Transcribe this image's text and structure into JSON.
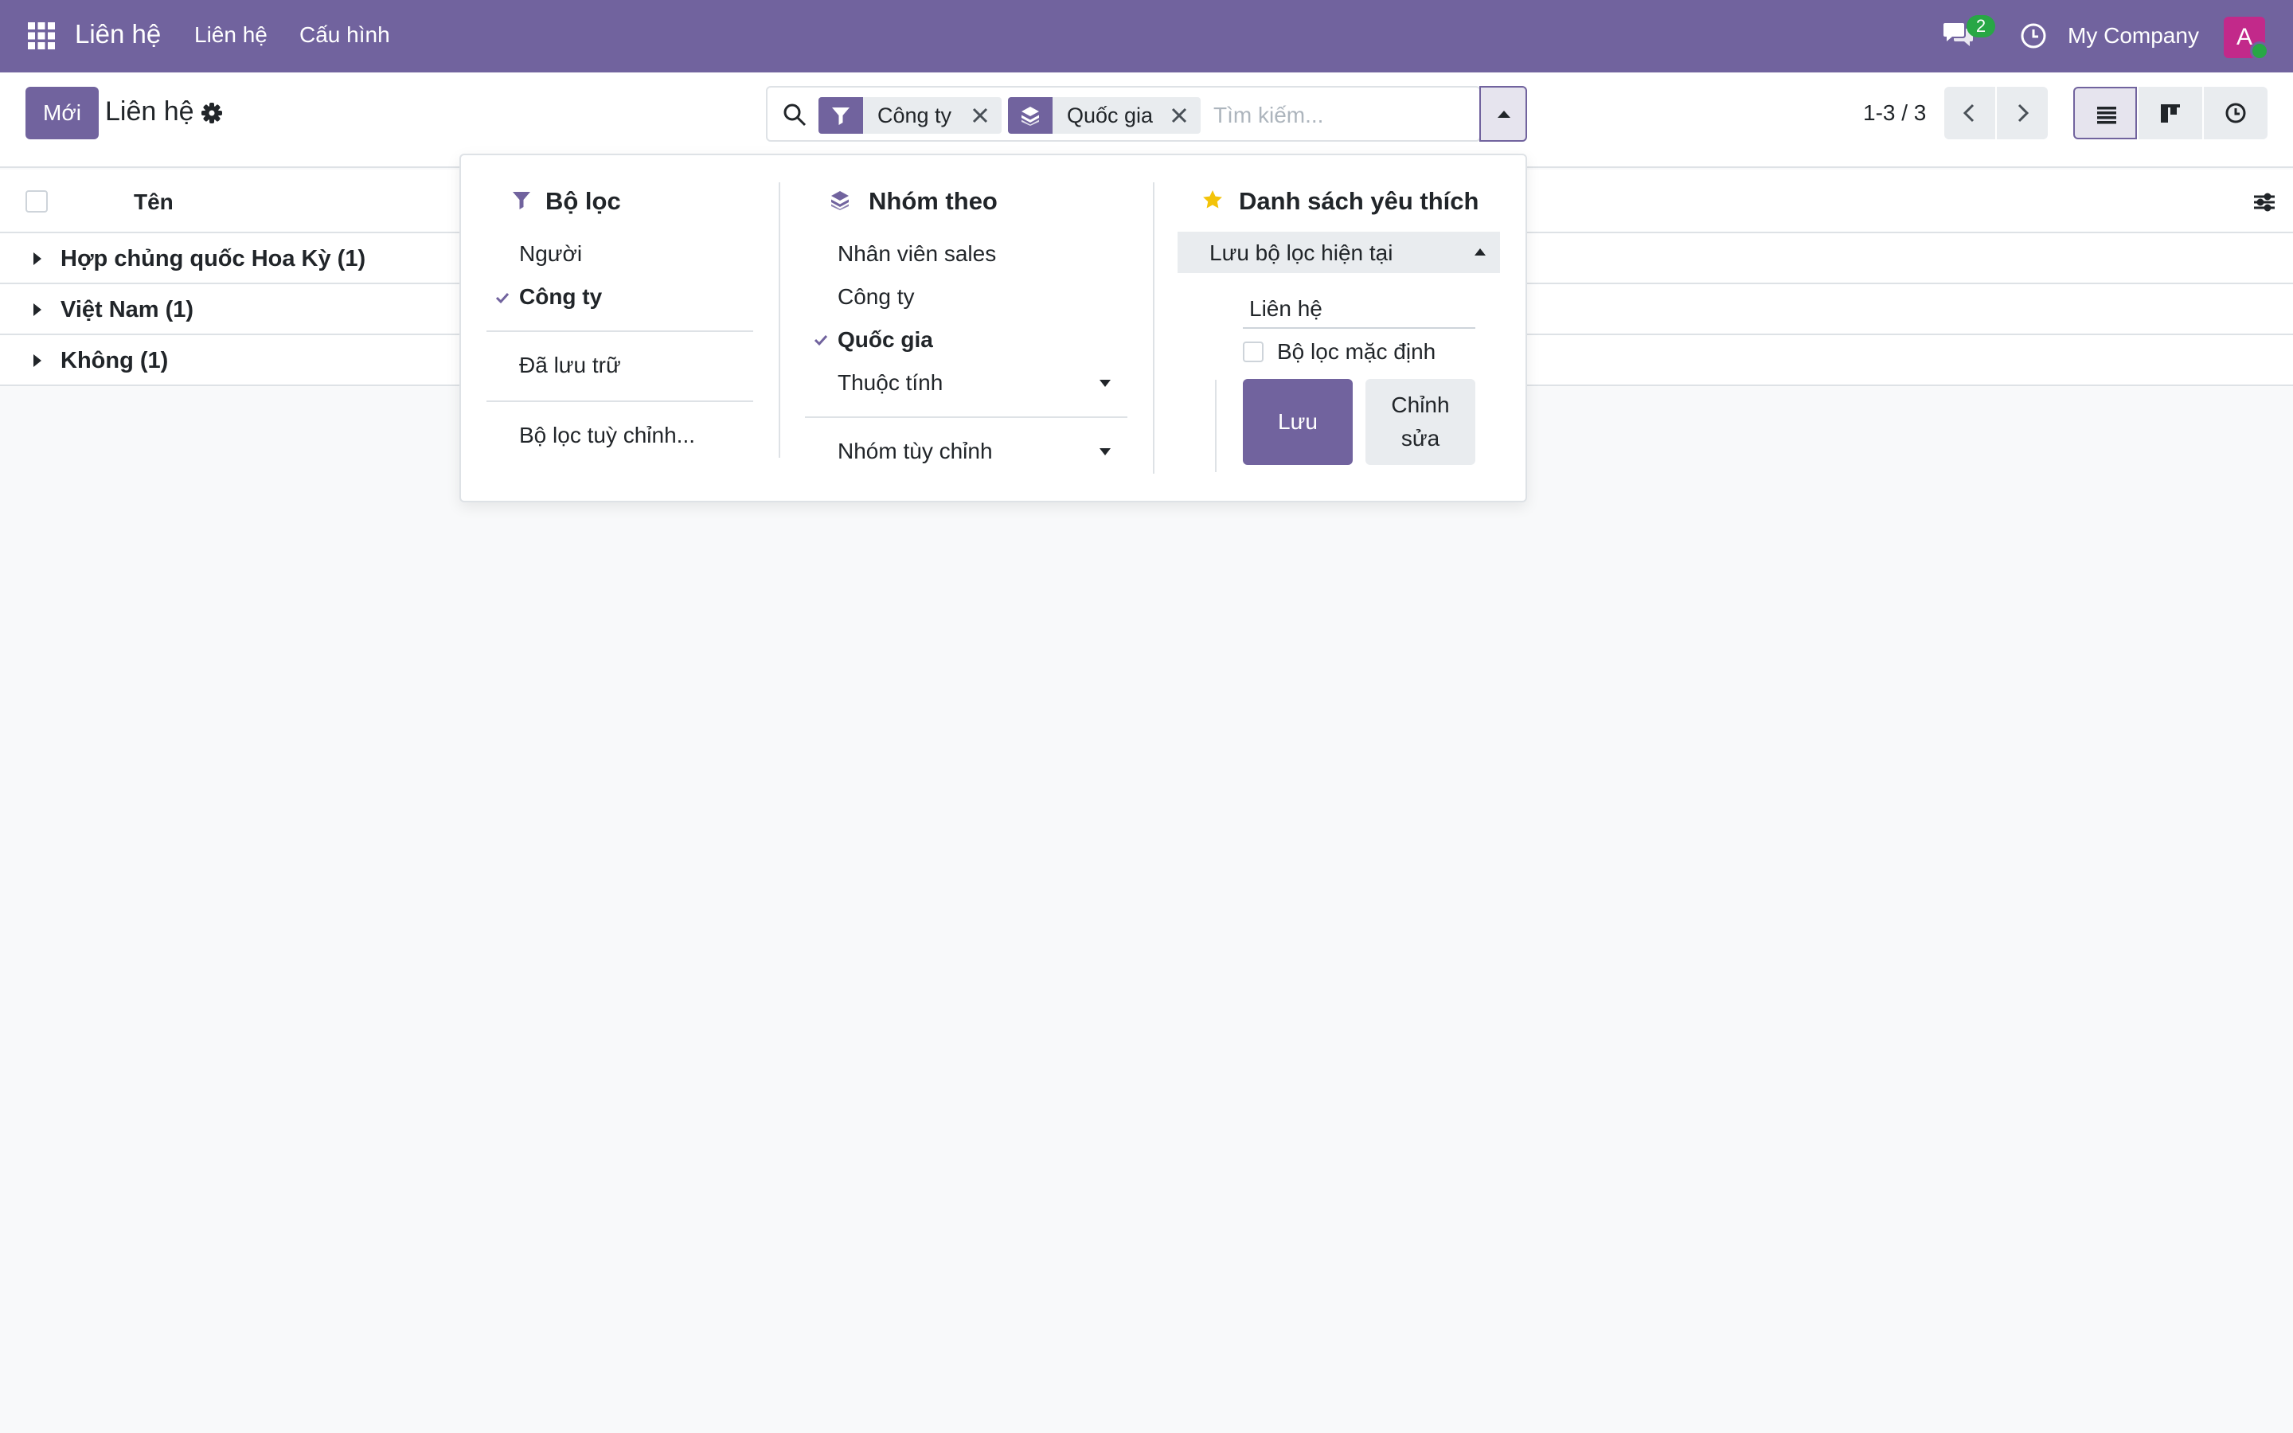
{
  "navbar": {
    "app_title": "Liên hệ",
    "menu_items": [
      "Liên hệ",
      "Cấu hình"
    ],
    "chat_badge": "2",
    "company": "My Company",
    "avatar_letter": "A",
    "color": "#71639e"
  },
  "control_panel": {
    "new_button": "Mới",
    "breadcrumb": "Liên hệ",
    "search": {
      "facets": [
        {
          "type": "filter",
          "icon": "filter-icon",
          "label": "Công ty"
        },
        {
          "type": "group",
          "icon": "layers-icon",
          "label": "Quốc gia"
        }
      ],
      "placeholder": "Tìm kiếm..."
    },
    "pager": "1-3 / 3",
    "views": [
      "list-view-icon",
      "kanban-view-icon",
      "activity-view-icon"
    ]
  },
  "list": {
    "header_name": "Tên",
    "groups": [
      {
        "label": "Hợp chủng quốc Hoa Kỳ (1)"
      },
      {
        "label": "Việt Nam (1)"
      },
      {
        "label": "Không (1)"
      }
    ]
  },
  "dropdown": {
    "filters": {
      "title": "Bộ lọc",
      "items": [
        {
          "label": "Người",
          "selected": false
        },
        {
          "label": "Công ty",
          "selected": true
        }
      ],
      "archived": "Đã lưu trữ",
      "custom": "Bộ lọc tuỳ chỉnh..."
    },
    "group_by": {
      "title": "Nhóm theo",
      "items": [
        {
          "label": "Nhân viên sales",
          "selected": false
        },
        {
          "label": "Công ty",
          "selected": false
        },
        {
          "label": "Quốc gia",
          "selected": true
        },
        {
          "label": "Thuộc tính",
          "selected": false
        }
      ],
      "custom": "Nhóm tùy chỉnh"
    },
    "favorites": {
      "title": "Danh sách yêu thích",
      "save_current": "Lưu bộ lọc hiện tại",
      "name_value": "Liên hệ",
      "default_label": "Bộ lọc mặc định",
      "save_button": "Lưu",
      "edit_button": "Chỉnh sửa"
    }
  }
}
